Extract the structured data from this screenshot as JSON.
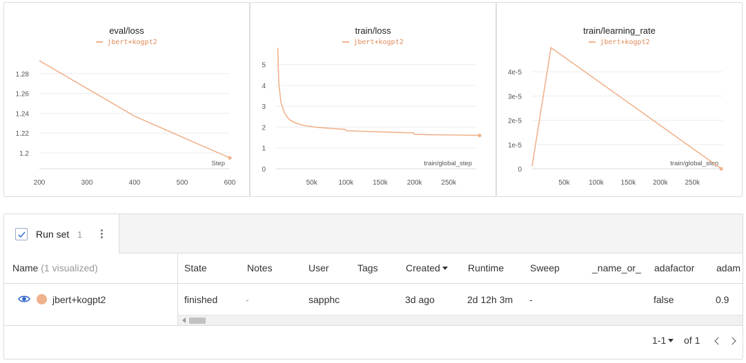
{
  "panels": [
    {
      "title": "eval/loss",
      "legend": "jbert+kogpt2",
      "xlabel": "Step",
      "xticks": [
        "200",
        "300",
        "400",
        "500",
        "600"
      ],
      "yticks": [
        "1.2",
        "1.22",
        "1.24",
        "1.26",
        "1.28"
      ]
    },
    {
      "title": "train/loss",
      "legend": "jbert+kogpt2",
      "xlabel": "train/global_step",
      "xticks": [
        "50k",
        "100k",
        "150k",
        "200k",
        "250k"
      ],
      "yticks": [
        "0",
        "1",
        "2",
        "3",
        "4",
        "5"
      ]
    },
    {
      "title": "train/learning_rate",
      "legend": "jbert+kogpt2",
      "xlabel": "train/global_step",
      "xticks": [
        "50k",
        "100k",
        "150k",
        "200k",
        "250k"
      ],
      "yticks": [
        "0",
        "1e-5",
        "2e-5",
        "3e-5",
        "4e-5"
      ]
    }
  ],
  "chart_data": [
    {
      "type": "line",
      "title": "eval/loss",
      "xlabel": "Step",
      "ylabel": "",
      "xlim": [
        200,
        600
      ],
      "ylim": [
        1.195,
        1.3
      ],
      "series": [
        {
          "name": "jbert+kogpt2",
          "x": [
            200,
            400,
            600
          ],
          "y": [
            1.293,
            1.237,
            1.195
          ]
        }
      ]
    },
    {
      "type": "line",
      "title": "train/loss",
      "xlabel": "train/global_step",
      "ylabel": "",
      "xlim": [
        0,
        295000
      ],
      "ylim": [
        0,
        5.5
      ],
      "series": [
        {
          "name": "jbert+kogpt2",
          "x": [
            500,
            2000,
            5000,
            10000,
            15000,
            20000,
            30000,
            40000,
            50000,
            60000,
            80000,
            99000,
            100000,
            120000,
            150000,
            180000,
            199000,
            200000,
            230000,
            260000,
            295000
          ],
          "y": [
            5.8,
            4.1,
            3.2,
            2.7,
            2.45,
            2.3,
            2.15,
            2.07,
            2.02,
            1.98,
            1.93,
            1.89,
            1.82,
            1.8,
            1.77,
            1.74,
            1.72,
            1.65,
            1.63,
            1.62,
            1.6
          ]
        }
      ]
    },
    {
      "type": "line",
      "title": "train/learning_rate",
      "xlabel": "train/global_step",
      "ylabel": "",
      "xlim": [
        0,
        295000
      ],
      "ylim": [
        0,
        5e-05
      ],
      "series": [
        {
          "name": "jbert+kogpt2",
          "x": [
            0,
            29500,
            295000
          ],
          "y": [
            1e-06,
            5e-05,
            0
          ]
        }
      ]
    }
  ],
  "runset": {
    "label": "Run set",
    "count": "1",
    "columns": {
      "name": "Name",
      "name_sub": "(1 visualized)",
      "state": "State",
      "notes": "Notes",
      "user": "User",
      "tags": "Tags",
      "created": "Created",
      "runtime": "Runtime",
      "sweep": "Sweep",
      "name_or": "_name_or_",
      "adafactor": "adafactor",
      "adam": "adam"
    },
    "row": {
      "name": "jbert+kogpt2",
      "color": "#f0b28c",
      "state": "finished",
      "notes": "-",
      "user": "sapphc",
      "created": "3d ago",
      "runtime": "2d 12h 3m",
      "sweep": "-",
      "adafactor": "false",
      "adam": "0.9"
    },
    "pagination": {
      "range": "1-1",
      "of": "of 1"
    }
  },
  "colors": {
    "series": "#f0b28c",
    "grid": "#ececec"
  }
}
